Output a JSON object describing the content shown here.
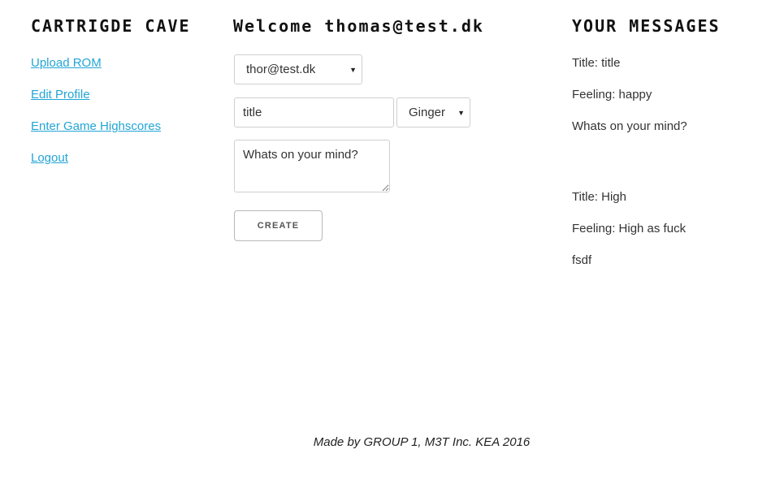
{
  "header": {
    "site_title": "CARTRIGDE CAVE",
    "welcome": "Welcome thomas@test.dk",
    "messages_title": "YOUR MESSAGES"
  },
  "nav": {
    "items": [
      {
        "label": "Upload ROM"
      },
      {
        "label": "Edit Profile"
      },
      {
        "label": "Enter Game Highscores"
      },
      {
        "label": "Logout"
      }
    ]
  },
  "form": {
    "recipient_selected": "thor@test.dk",
    "title_value": "title",
    "feeling_selected": "Ginger",
    "mind_placeholder": "Whats on your mind?",
    "create_label": "CREATE"
  },
  "messages": [
    {
      "title": "Title: title",
      "feeling": "Feeling: happy",
      "body": "Whats on your mind?"
    },
    {
      "title": "Title: High",
      "feeling": "Feeling: High as fuck",
      "body": "fsdf"
    }
  ],
  "footer": {
    "text": "Made by GROUP 1, M3T Inc. KEA 2016"
  },
  "colors": {
    "link": "#22a5d6",
    "heading": "#111111",
    "text": "#333333",
    "border": "#cfcfcf"
  },
  "icons": {
    "select_arrow": "caret-down-icon"
  }
}
